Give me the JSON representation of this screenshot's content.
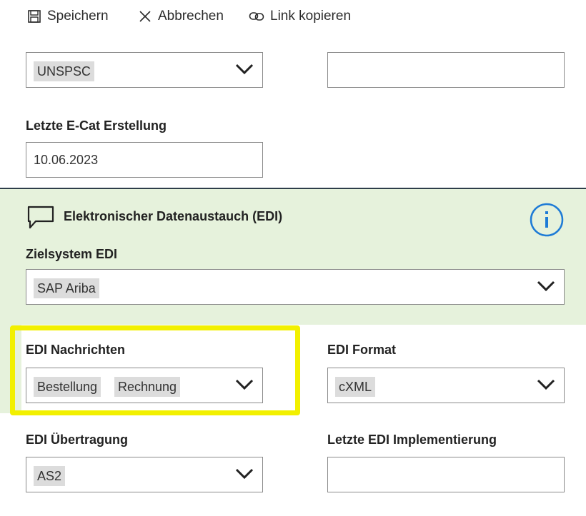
{
  "toolbar": {
    "save_label": "Speichern",
    "cancel_label": "Abbrechen",
    "copy_link_label": "Link kopieren"
  },
  "classification": {
    "selected": "UNSPSC",
    "code_value": ""
  },
  "ecat": {
    "label": "Letzte E-Cat Erstellung",
    "value": "10.06.2023"
  },
  "edi": {
    "section_title": "Elektronischer Datenaustauch (EDI)",
    "target_system_label": "Zielsystem EDI",
    "target_system_value": "SAP Ariba",
    "messages_label": "EDI Nachrichten",
    "messages_values": [
      "Bestellung",
      "Rechnung"
    ],
    "format_label": "EDI Format",
    "format_value": "cXML",
    "transfer_label": "EDI Übertragung",
    "transfer_value": "AS2",
    "last_impl_label": "Letzte EDI Implementierung",
    "last_impl_value": ""
  },
  "colors": {
    "section_bg": "#e6f2dc",
    "info_icon": "#1e7bd6",
    "highlight": "#f2f000",
    "tag_bg": "#dcdcdc"
  }
}
